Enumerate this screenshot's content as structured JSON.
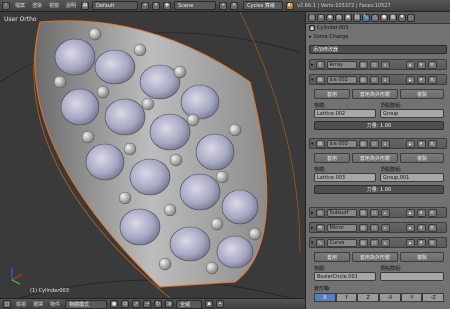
{
  "topbar": {
    "menus": [
      "檔案",
      "渲染",
      "視窗",
      "說明"
    ],
    "layout": "Default",
    "scene": "Scene",
    "engine": "Cycles 算繪",
    "stats": "v2.66.1 | Verts:105372 | Faces:10527"
  },
  "viewport": {
    "view_label": "User Ortho",
    "object_label": "(1) Cylinder003"
  },
  "bottombar": {
    "menus": [
      "檢視",
      "選擇",
      "物件"
    ],
    "mode": "物體模式",
    "pivot": "全域"
  },
  "props": {
    "breadcrumb": "Cylinder.003",
    "some_change": "Some Change",
    "add_modifier": "添加修改器",
    "mods": [
      {
        "name": "Array"
      },
      {
        "name": "ice.002",
        "apply": "套用",
        "apply_shape": "套用為外形鍵",
        "copy": "複製",
        "object_label": "物體:",
        "object": "Lattice.002",
        "vgroup_label": "頂點群組:",
        "vgroup": "Group",
        "strength": "力量: 1.00"
      },
      {
        "name": "ice.003",
        "apply": "套用",
        "apply_shape": "套用為外形鍵",
        "copy": "複製",
        "object_label": "物體:",
        "object": "Lattice.003",
        "vgroup_label": "頂點群組:",
        "vgroup": "Group.001",
        "strength": "力量: 1.00"
      },
      {
        "name": "Subsurf"
      },
      {
        "name": "Mirror"
      },
      {
        "name": "Curve",
        "apply": "套用",
        "apply_shape": "套用為外形鍵",
        "copy": "複製",
        "object_label": "物體:",
        "object": "BezierCircle.001",
        "vgroup_label": "頂點群組:",
        "vgroup": ""
      }
    ],
    "deform_axis": "變形軸:",
    "axes": [
      "X",
      "Y",
      "Z",
      "-X",
      "-Y",
      "-Z"
    ]
  }
}
